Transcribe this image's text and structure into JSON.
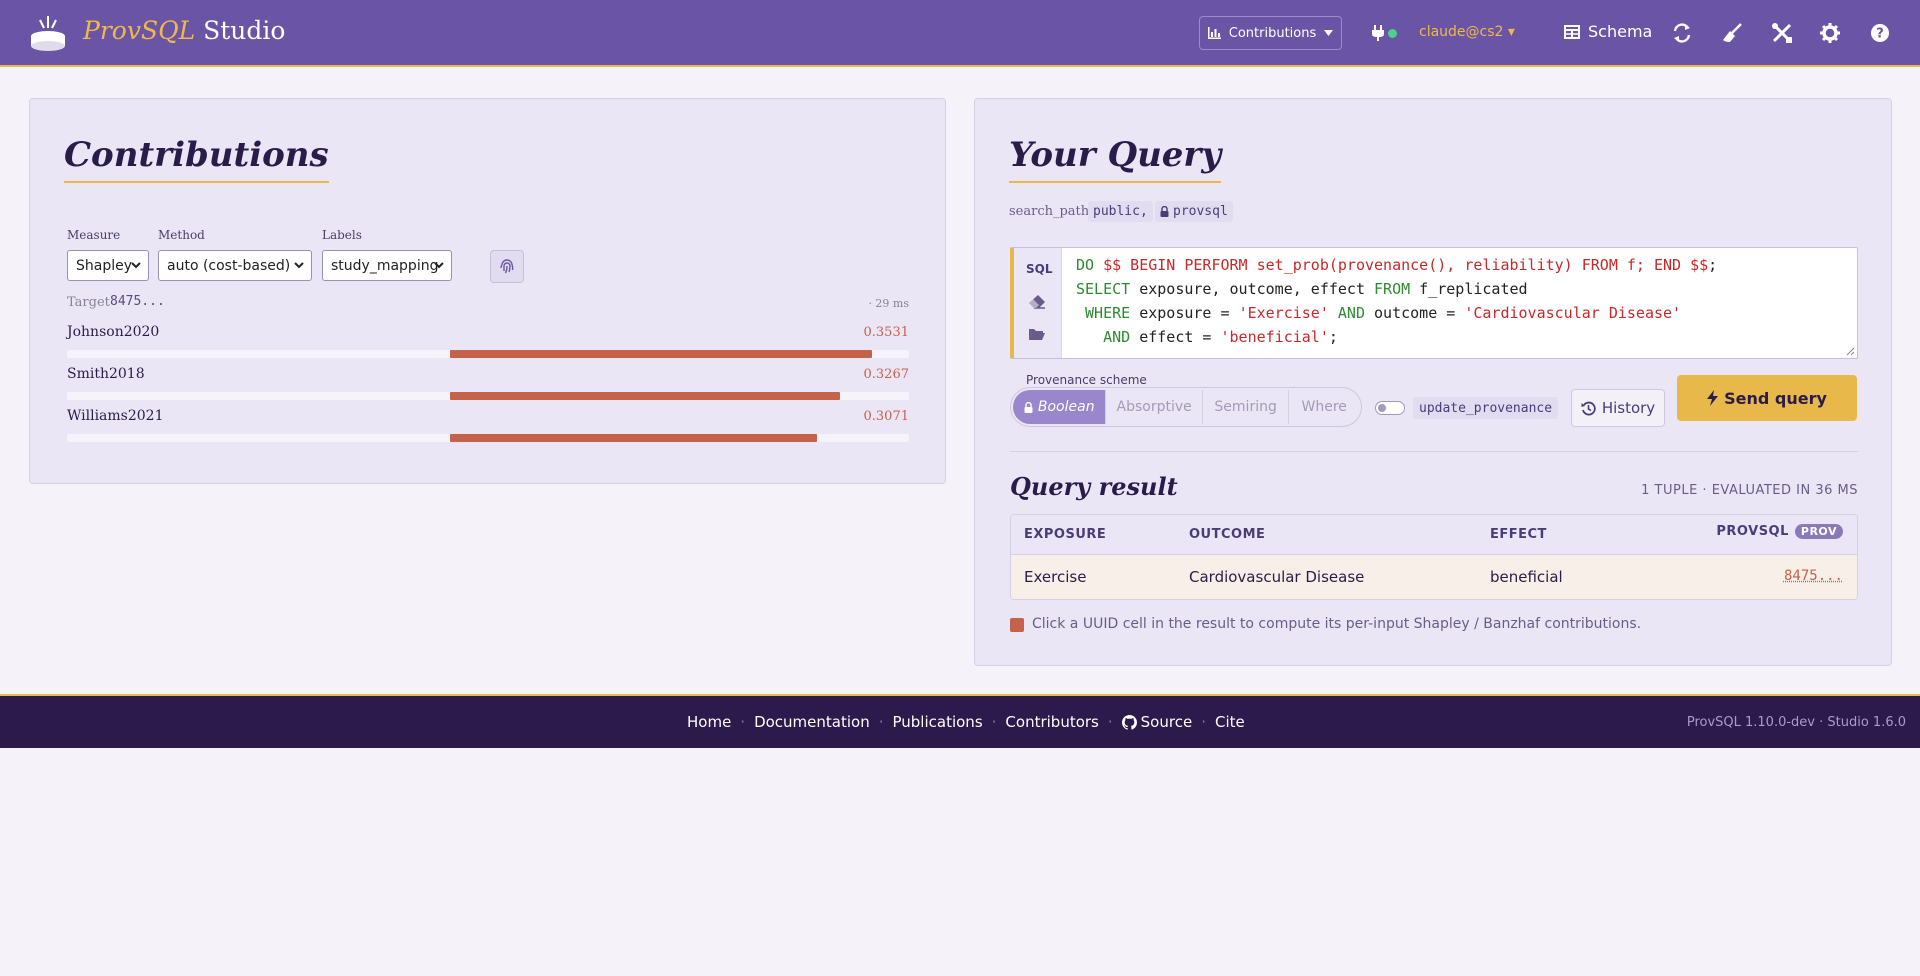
{
  "header": {
    "brand_em": "ProvSQL",
    "brand_rest": " Studio",
    "mode_label": "Contributions",
    "user": "claude@cs2 ▾",
    "schema_label": "Schema"
  },
  "contributions": {
    "title": "Contributions",
    "measure_label": "Measure",
    "measure_value": "Shapley",
    "method_label": "Method",
    "method_value": "auto (cost-based)",
    "labels_label": "Labels",
    "labels_value": "study_mapping",
    "target_label": "Target",
    "target_value": "8475...",
    "elapsed": "· 29 ms",
    "rows": [
      {
        "name": "Johnson2020",
        "value": "0.3531",
        "fraction": 1.0
      },
      {
        "name": "Smith2018",
        "value": "0.3267",
        "fraction": 0.925
      },
      {
        "name": "Williams2021",
        "value": "0.3071",
        "fraction": 0.87
      }
    ]
  },
  "query": {
    "title": "Your Query",
    "search_path_label": "search_path:",
    "search_path_public": "public,",
    "search_path_provsql": "provsql",
    "sql_label": "SQL",
    "scheme_label": "Provenance scheme",
    "schemes": [
      "Boolean",
      "Absorptive",
      "Semiring",
      "Where"
    ],
    "update_provenance": "update_provenance",
    "history_label": "History",
    "send_label": "Send query"
  },
  "result": {
    "title": "Query result",
    "meta": "1 TUPLE · EVALUATED IN 36 MS",
    "columns": [
      "EXPOSURE",
      "OUTCOME",
      "EFFECT",
      "PROVSQL"
    ],
    "prov_badge": "PROV",
    "row": [
      "Exercise",
      "Cardiovascular Disease",
      "beneficial",
      "8475..."
    ],
    "hint": "Click a UUID cell in the result to compute its per-input Shapley / Banzhaf contributions."
  },
  "footer": {
    "links": [
      "Home",
      "Documentation",
      "Publications",
      "Contributors",
      "Source",
      "Cite"
    ],
    "version": "ProvSQL 1.10.0-dev · Studio 1.6.0"
  },
  "colors": {
    "header_bg": "#6a54a6",
    "accent": "#e8b84a",
    "bar": "#c4624a",
    "footer_bg": "#2c1a4d"
  }
}
